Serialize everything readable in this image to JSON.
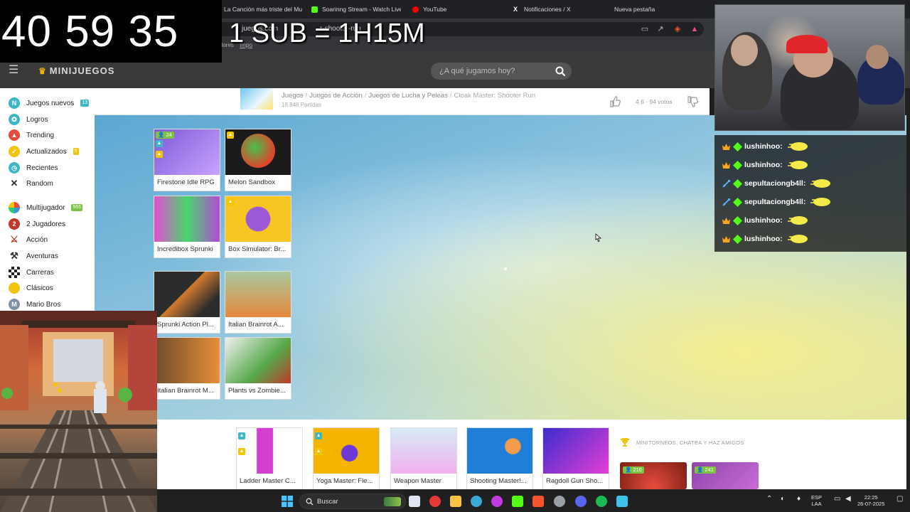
{
  "browser": {
    "tabs": [
      {
        "label": "La Canción más triste del Mun",
        "color": "#e53935"
      },
      {
        "label": "Soarinng Stream - Watch Live c",
        "color": "#53fc18"
      },
      {
        "label": "YouTube",
        "color": "#ff0000"
      },
      {
        "label": "Notificaciones / X",
        "color": "#ffffff"
      },
      {
        "label": "Nueva pestaña",
        "color": "#888888"
      }
    ],
    "url_partial_start": "juegos.com",
    "url_partial_end": "r-shooter-run",
    "bookmarks_fragment": "gadores",
    "bookmarks_fragment2": "Impo"
  },
  "overlay": {
    "timer": "40 59 35",
    "sub_rate": "1 SUB = 1H15M"
  },
  "header": {
    "logo": "MINIJUEGOS",
    "search_placeholder": "¿A qué jugamos hoy?"
  },
  "sidebar": {
    "items": [
      {
        "label": "Juegos nuevos",
        "icon": "new-icon",
        "badge": "13",
        "badge_color": "teal"
      },
      {
        "label": "Logros",
        "icon": "achievements-icon"
      },
      {
        "label": "Trending",
        "icon": "trending-icon"
      },
      {
        "label": "Actualizados",
        "icon": "updated-icon",
        "badge": "5",
        "badge_color": "yellow"
      },
      {
        "label": "Recientes",
        "icon": "recent-icon"
      },
      {
        "label": "Random",
        "icon": "random-icon"
      },
      {
        "label": "Multijugador",
        "icon": "multiplayer-icon",
        "badge": "955",
        "badge_color": "green"
      },
      {
        "label": "2 Jugadores",
        "icon": "two-players-icon"
      },
      {
        "label": "Acción",
        "icon": "action-icon"
      },
      {
        "label": "Aventuras",
        "icon": "adventure-icon"
      },
      {
        "label": "Carreras",
        "icon": "racing-icon"
      },
      {
        "label": "Clásicos",
        "icon": "classic-icon"
      },
      {
        "label": "Mario Bros",
        "icon": "mario-icon"
      }
    ]
  },
  "game_info": {
    "breadcrumbs": [
      "Juegos",
      "Juegos de Acción",
      "Juegos de Lucha y Peleas"
    ],
    "current": "Cloak Master: Shooter Run",
    "plays": "18.848 Partidas",
    "rating": "4.6 · 94 votos"
  },
  "side_games": [
    {
      "name": "Firestone Idle RPG",
      "players": "24",
      "colors": [
        "#7b5bd6",
        "#c9a3ff"
      ]
    },
    {
      "name": "Melon Sandbox",
      "colors": [
        "#1b1b1b",
        "#e0442a"
      ]
    },
    {
      "name": "Incredibox Sprunki",
      "colors": [
        "#e24fd0",
        "#48d66a"
      ]
    },
    {
      "name": "Box Simulator: Br...",
      "colors": [
        "#f7c623",
        "#9b59d6"
      ]
    },
    {
      "name": "Sprunki Action Pl...",
      "colors": [
        "#2c2c2c",
        "#d27b2c"
      ]
    },
    {
      "name": "Italian Brainrot A...",
      "colors": [
        "#a8c9a0",
        "#e6893d"
      ]
    },
    {
      "name": "Italian Brainrot M...",
      "colors": [
        "#6e4b2c",
        "#e88f3a"
      ]
    },
    {
      "name": "Plants vs Zombie...",
      "colors": [
        "#f0f0f0",
        "#56a84a"
      ]
    }
  ],
  "bottom_games": [
    {
      "name": "Ladder Master C...",
      "colors": [
        "#ffffff",
        "#d43fd1"
      ]
    },
    {
      "name": "Yoga Master: Fle...",
      "colors": [
        "#f4b400",
        "#6b3ad6"
      ]
    },
    {
      "name": "Weapon Master",
      "colors": [
        "#d6ecf7",
        "#f2b0ef"
      ]
    },
    {
      "name": "Shooting Master!...",
      "colors": [
        "#1f7ed6",
        "#f39c4b"
      ]
    },
    {
      "name": "Ragdoll Gun Sho...",
      "colors": [
        "#3b2ccf",
        "#e43fd4"
      ]
    }
  ],
  "promo": {
    "heading": "MINITORNEOS, CHATEA Y HAZ AMIGOS",
    "cards": [
      {
        "players": "216",
        "color": "#c0392b"
      },
      {
        "players": "241",
        "color": "#8e44ad"
      }
    ]
  },
  "chat": [
    {
      "user": "lushinhoo:",
      "badge": "crown"
    },
    {
      "user": "lushinhoo:",
      "badge": "crown"
    },
    {
      "user": "sepultaciongb4ll:",
      "badge": "sword"
    },
    {
      "user": "sepultaciongb4ll:",
      "badge": "sword"
    },
    {
      "user": "lushinhoo:",
      "badge": "crown"
    },
    {
      "user": "lushinhoo:",
      "badge": "crown"
    }
  ],
  "taskbar": {
    "search_label": "Buscar",
    "lang": "ESP",
    "region": "LAA",
    "time": "22:25",
    "date": "26-07-2025"
  }
}
